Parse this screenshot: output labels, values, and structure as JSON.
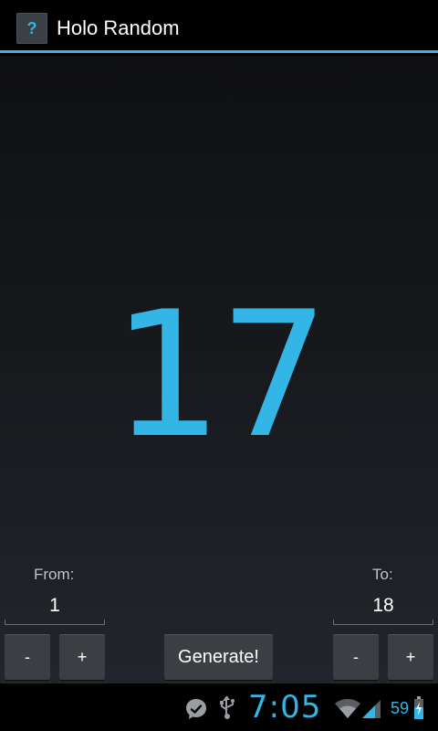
{
  "app": {
    "icon_glyph": "?",
    "title": "Holo Random"
  },
  "result": {
    "value": "17"
  },
  "range": {
    "from_label": "From:",
    "from_value": "1",
    "to_label": "To:",
    "to_value": "18"
  },
  "buttons": {
    "from_decrement": "-",
    "from_increment": "+",
    "generate": "Generate!",
    "to_decrement": "-",
    "to_increment": "+"
  },
  "status_bar": {
    "time": "7:05",
    "battery": "59",
    "icons": [
      "messenger-icon",
      "usb-icon",
      "wifi-icon",
      "signal-icon",
      "battery-charging-icon"
    ]
  },
  "colors": {
    "accent": "#33b5e5",
    "button_bg": "#3b3f44",
    "background_top": "#0f1012",
    "background_bottom": "#22262c"
  }
}
